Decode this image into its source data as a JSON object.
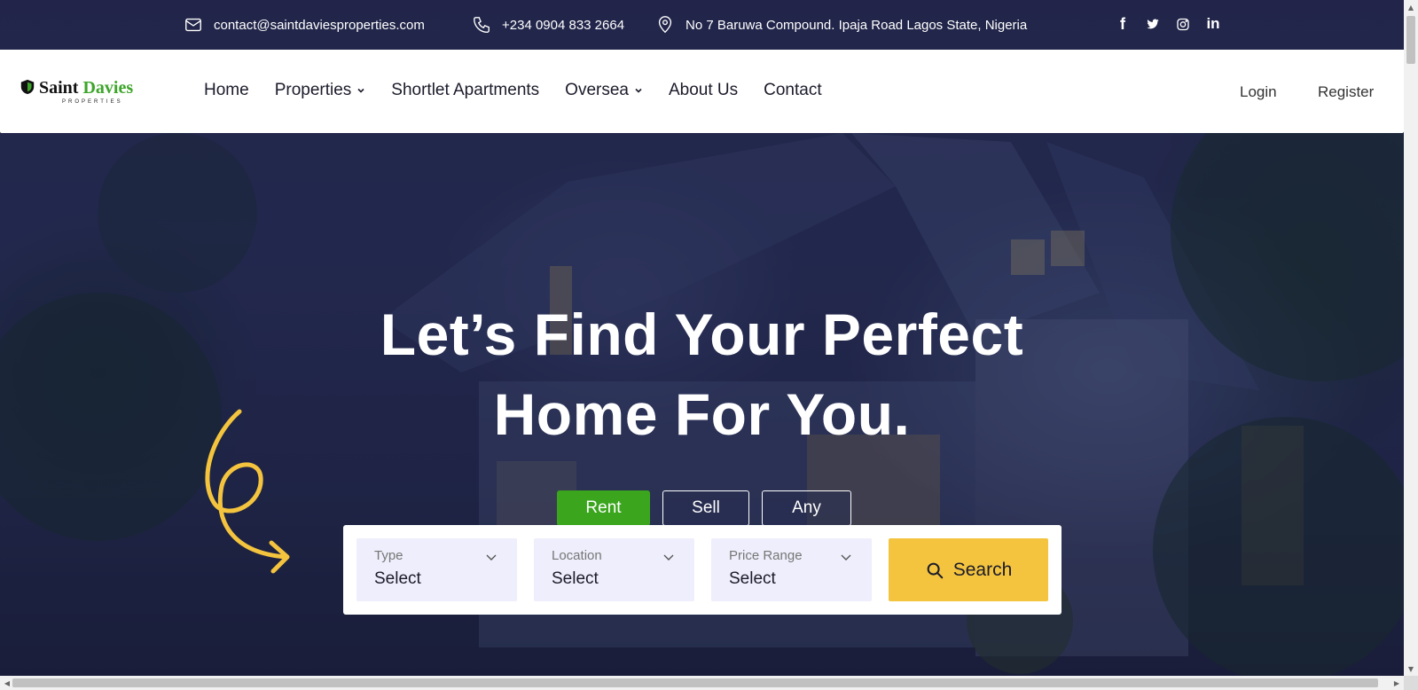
{
  "topbar": {
    "email": "contact@saintdaviesproperties.com",
    "phone": "+234 0904 833 2664",
    "address": "No 7 Baruwa Compound. Ipaja Road Lagos State, Nigeria",
    "socials": [
      "facebook-icon",
      "twitter-icon",
      "instagram-icon",
      "linkedin-icon"
    ],
    "social_glyphs": {
      "facebook": "f",
      "linkedin": "in"
    }
  },
  "brand": {
    "name_part1": "Saint",
    "name_part2": "Davies",
    "subtitle": "PROPERTIES",
    "accent_color": "#3da52a"
  },
  "nav": {
    "home": "Home",
    "properties": "Properties",
    "shortlet": "Shortlet Apartments",
    "oversea": "Oversea",
    "about": "About Us",
    "contact": "Contact",
    "login": "Login",
    "register": "Register"
  },
  "hero": {
    "title_line1": "Let’s Find Your Perfect",
    "title_line2": "Home For You."
  },
  "tabs": {
    "rent": "Rent",
    "sell": "Sell",
    "any": "Any",
    "active": "Rent",
    "active_color": "#3aa51d"
  },
  "search": {
    "type_label": "Type",
    "type_value": "Select",
    "location_label": "Location",
    "location_value": "Select",
    "price_label": "Price Range",
    "price_value": "Select",
    "button_label": "Search",
    "button_color": "#f4c43e"
  }
}
